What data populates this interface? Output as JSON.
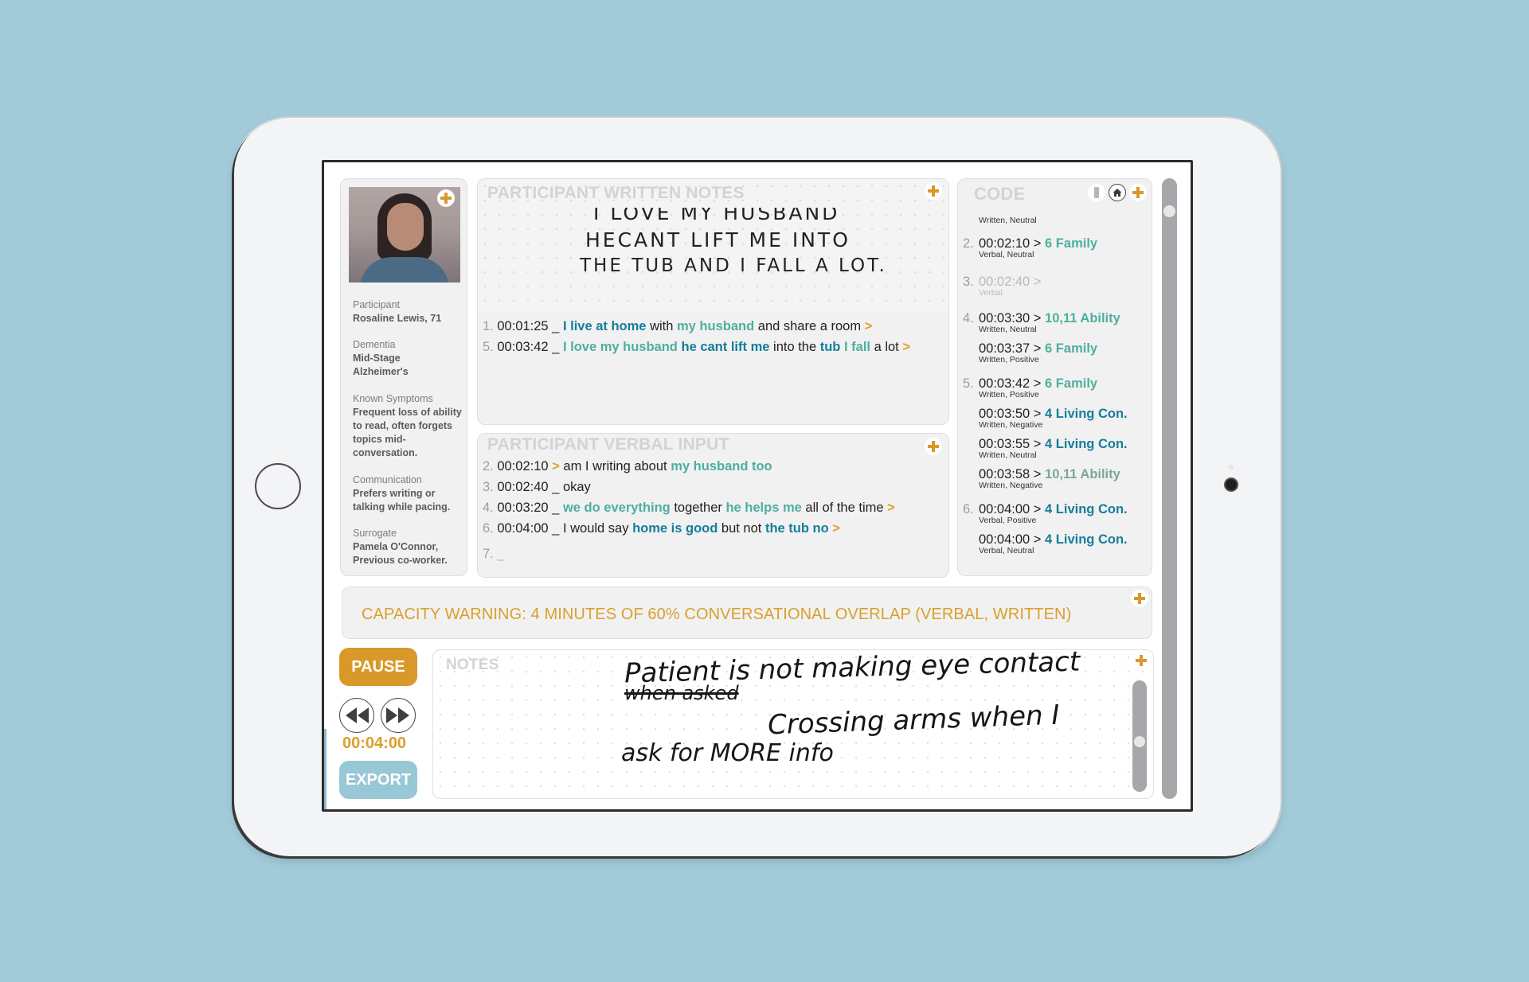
{
  "profile": {
    "photo_alt": "participant-photo",
    "fields": [
      {
        "label": "Participant",
        "value": "Rosaline Lewis, 71"
      },
      {
        "label": "Dementia",
        "value": "Mid-Stage Alzheimer's"
      },
      {
        "label": "Known Symptoms",
        "value": "Frequent loss of ability to read, often forgets topics mid-conversation."
      },
      {
        "label": "Communication",
        "value": "Prefers writing or talking while pacing."
      },
      {
        "label": "Surrogate",
        "value": "Pamela O'Connor, Previous co-worker."
      }
    ]
  },
  "written_notes": {
    "title": "PARTICIPANT WRITTEN NOTES",
    "handwriting": [
      "I LOVE MY HUSBAND",
      "HECANT LIFT ME INTO",
      "THE TUB AND I FALL A LOT."
    ],
    "lines": [
      {
        "num": "1.",
        "time": "00:01:25",
        "sep": "_",
        "segments": [
          {
            "text": "I live at home",
            "style": "blue"
          },
          {
            "text": " with ",
            "style": "plain"
          },
          {
            "text": "my husband",
            "style": "teal"
          },
          {
            "text": " and share a room ",
            "style": "plain"
          },
          {
            "text": ">",
            "style": "arrow"
          }
        ]
      },
      {
        "num": "5.",
        "time": "00:03:42",
        "sep": "_",
        "segments": [
          {
            "text": "I love my husband",
            "style": "teal"
          },
          {
            "text": " ",
            "style": "plain"
          },
          {
            "text": "he cant lift me",
            "style": "blue"
          },
          {
            "text": " into the ",
            "style": "plain"
          },
          {
            "text": "tub",
            "style": "blue"
          },
          {
            "text": " ",
            "style": "plain"
          },
          {
            "text": "I fall",
            "style": "teal"
          },
          {
            "text": " a lot ",
            "style": "plain"
          },
          {
            "text": ">",
            "style": "arrow"
          }
        ]
      }
    ]
  },
  "verbal_input": {
    "title": "PARTICIPANT VERBAL INPUT",
    "lines": [
      {
        "num": "2.",
        "time": "00:02:10",
        "sep": ">",
        "segments": [
          {
            "text": " am I writing about ",
            "style": "plain"
          },
          {
            "text": "my husband too",
            "style": "teal"
          }
        ]
      },
      {
        "num": "3.",
        "time": "00:02:40",
        "sep": "_",
        "segments": [
          {
            "text": " okay",
            "style": "plain"
          }
        ]
      },
      {
        "num": "4.",
        "time": "00:03:20",
        "sep": "_",
        "segments": [
          {
            "text": " ",
            "style": "plain"
          },
          {
            "text": "we do everything",
            "style": "teal"
          },
          {
            "text": " together ",
            "style": "plain"
          },
          {
            "text": "he helps me",
            "style": "teal"
          },
          {
            "text": " all of the time ",
            "style": "plain"
          },
          {
            "text": ">",
            "style": "arrow"
          }
        ]
      },
      {
        "num": "6.",
        "time": "00:04:00",
        "sep": "_",
        "segments": [
          {
            "text": " I would say ",
            "style": "plain"
          },
          {
            "text": "home is good",
            "style": "blue"
          },
          {
            "text": " but not ",
            "style": "plain"
          },
          {
            "text": "the tub no",
            "style": "blue"
          },
          {
            "text": " >",
            "style": "arrow"
          }
        ]
      },
      {
        "num": "7.",
        "time": "",
        "sep": "_",
        "segments": []
      }
    ]
  },
  "code": {
    "title": "CODE",
    "icons": [
      "bar-icon",
      "home-icon",
      "add-icon"
    ],
    "entries": [
      {
        "num": "",
        "time": "",
        "tag": "",
        "tag_style": "",
        "sub": "Written, Neutral",
        "faded": false
      },
      {
        "num": "2.",
        "time": "00:02:10 >",
        "tag": "6 Family",
        "tag_style": "teal",
        "sub": "Verbal, Neutral",
        "faded": false
      },
      {
        "num": "3.",
        "time": "00:02:40 >",
        "tag": "",
        "tag_style": "",
        "sub": "Verbal",
        "faded": true
      },
      {
        "num": "4.",
        "time": "00:03:30 >",
        "tag": "10,11 Ability",
        "tag_style": "teal",
        "sub": "Written, Neutral",
        "faded": false
      },
      {
        "num": "",
        "time": "00:03:37 >",
        "tag": " 6 Family",
        "tag_style": "teal",
        "sub": "Written, Positive",
        "faded": false
      },
      {
        "num": "5.",
        "time": "00:03:42 >",
        "tag": "6 Family",
        "tag_style": "teal",
        "sub": "Written, Positive",
        "faded": false
      },
      {
        "num": "",
        "time": "00:03:50 >",
        "tag": "4 Living Con.",
        "tag_style": "blue",
        "sub": "Written, Negative",
        "faded": false
      },
      {
        "num": "",
        "time": "00:03:55 >",
        "tag": "4 Living Con.",
        "tag_style": "blue",
        "sub": "Written, Neutral",
        "faded": false
      },
      {
        "num": "",
        "time": "00:03:58 >",
        "tag": "10,11 Ability",
        "tag_style": "gray",
        "sub": "Written, Negative",
        "faded": false
      },
      {
        "num": "6.",
        "time": "00:04:00 >",
        "tag": "4 Living Con.",
        "tag_style": "blue",
        "sub": "Verbal, Positive",
        "faded": false
      },
      {
        "num": "",
        "time": "00:04:00 >",
        "tag": "4 Living Con.",
        "tag_style": "blue",
        "sub": "Verbal, Neutral",
        "faded": false
      }
    ]
  },
  "warning": {
    "text": "CAPACITY WARNING: 4 MINUTES OF 60% CONVERSATIONAL OVERLAP (VERBAL, WRITTEN)"
  },
  "controls": {
    "pause_label": "PAUSE",
    "timer": "00:04:00",
    "export_label": "EXPORT"
  },
  "notes": {
    "title": "NOTES",
    "handwriting": [
      "Patient is not making eye contact",
      "when asked",
      "Crossing arms when I",
      "ask for MORE info"
    ]
  },
  "colors": {
    "background": "#a2cbd9",
    "accent_orange": "#d9992a",
    "teal": "#4eaf9c",
    "blue": "#167d99",
    "export_blue": "#98c7d6"
  }
}
